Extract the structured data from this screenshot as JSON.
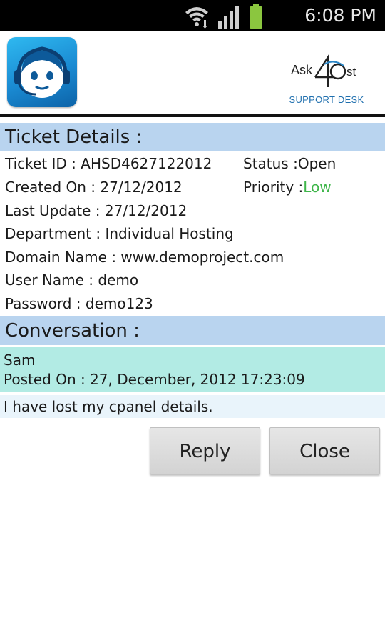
{
  "status_bar": {
    "time": "6:08 PM"
  },
  "header": {
    "brand_name": "Ask4Host",
    "brand_subtitle": "SUPPORT DESK"
  },
  "ticket": {
    "section_title": "Ticket Details :",
    "ticket_id": "Ticket ID : AHSD4627122012",
    "status_label": "Status :",
    "status_value": "Open",
    "created_on": "Created On : 27/12/2012",
    "priority_label": "Priority :",
    "priority_value": "Low",
    "last_update": "Last Update : 27/12/2012",
    "department": "Department : Individual Hosting",
    "domain_name": "Domain Name : www.demoproject.com",
    "user_name": "User Name : demo",
    "password": "Password : demo123",
    "priority_color": "#3fb64a"
  },
  "conversation": {
    "section_title": "Conversation :",
    "messages": [
      {
        "author": "Sam",
        "posted_on": "Posted On : 27, December, 2012 17:23:09",
        "text": "I have lost my cpanel details."
      }
    ]
  },
  "actions": {
    "reply_label": "Reply",
    "close_label": "Close"
  },
  "colors": {
    "section_bg": "#b9d4ef",
    "message_header_bg": "#b2ebe4",
    "message_body_bg": "#e9f4fb"
  },
  "icons": [
    "wifi-icon",
    "signal-icon",
    "battery-icon",
    "support-agent-icon"
  ]
}
